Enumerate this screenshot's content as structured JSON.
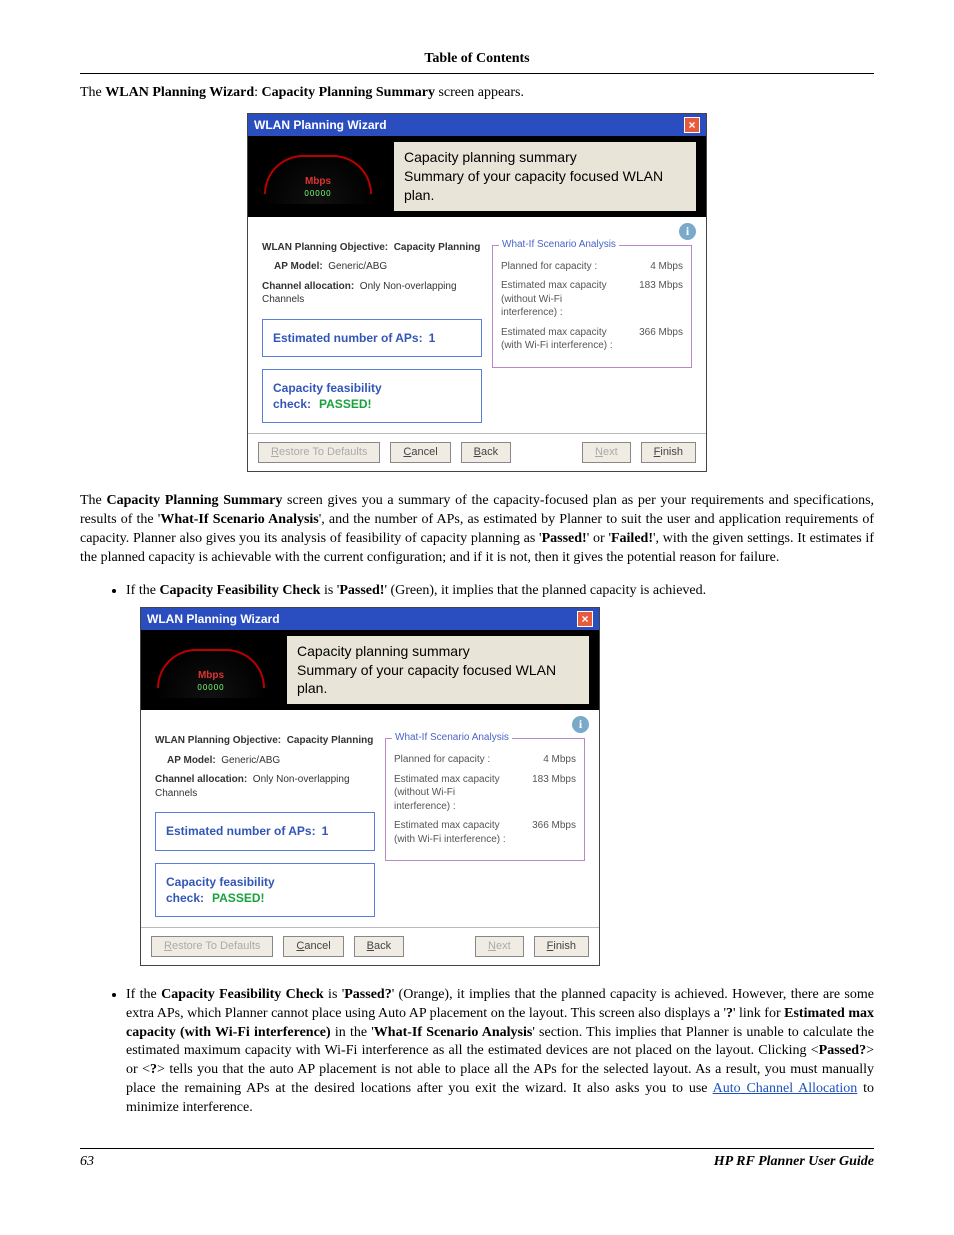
{
  "toc_header": "Table of Contents",
  "intro": {
    "pre": "The ",
    "b1": "WLAN Planning Wizard",
    "mid": ": ",
    "b2": "Capacity Planning Summary",
    "post": " screen appears."
  },
  "wizard": {
    "title": "WLAN Planning Wizard",
    "gauge_label": "Mbps",
    "gauge_digits": "00000",
    "heading": "Capacity planning summary",
    "subheading": "Summary of your capacity focused WLAN plan.",
    "objective_label": "WLAN Planning Objective:",
    "objective_value": "Capacity Planning",
    "ap_model_label": "AP Model:",
    "ap_model_value": "Generic/ABG",
    "channel_label": "Channel allocation:",
    "channel_value": "Only Non-overlapping Channels",
    "est_ap_label": "Estimated number of APs:",
    "est_ap_value": "1",
    "feas_label": "Capacity feasibility check:",
    "feas_value": "PASSED!",
    "whatif_legend": "What-If Scenario Analysis",
    "row1_label": "Planned for capacity :",
    "row1_value": "4 Mbps",
    "row2_label": "Estimated max capacity (without Wi-Fi interference) :",
    "row2_value": "183 Mbps",
    "row3_label": "Estimated max capacity (with Wi-Fi interference) :",
    "row3_value": "366 Mbps",
    "btn_restore": "Restore To Defaults",
    "btn_cancel": "Cancel",
    "btn_back": "Back",
    "btn_next": "Next",
    "btn_finish": "Finish"
  },
  "para1": {
    "a": "The ",
    "b": "Capacity Planning Summary",
    "c": " screen gives you a summary of the capacity-focused plan as per your requirements and specifications, results of the '",
    "d": "What-If Scenario Analysis",
    "e": "', and the number of APs, as estimated by Planner to suit the user and application requirements of capacity. Planner also gives you its analysis of feasibility of capacity planning as '",
    "f": "Passed!",
    "g": "' or '",
    "h": "Failed!",
    "i": "', with the given settings. It estimates if the planned capacity is achievable with the current configuration; and if it is not, then it gives the potential reason for failure."
  },
  "bullet1": {
    "a": "If the ",
    "b": "Capacity Feasibility Check",
    "c": " is '",
    "d": "Passed!",
    "e": "' (Green), it implies that the planned capacity is achieved."
  },
  "bullet2": {
    "a": "If the ",
    "b": "Capacity Feasibility Check",
    "c": " is '",
    "d": "Passed?",
    "e": "' (Orange), it implies that the planned capacity is achieved. However, there are some extra APs, which Planner cannot place using Auto AP placement on the layout. This screen also displays a '",
    "f": "?",
    "g": "' link for ",
    "h": "Estimated max capacity (with Wi-Fi interference)",
    "i": " in the '",
    "j": "What-If Scenario Analysis",
    "k": "' section. This implies that Planner is unable to calculate the estimated maximum capacity with Wi-Fi interference as all the estimated devices are not placed on the layout. Clicking <",
    "l": "Passed?",
    "m": "> or <",
    "n": "?",
    "o": "> tells you that the auto AP placement is not able to place all the APs for the selected layout. As a result, you must manually place the remaining APs at the desired locations after you exit the wizard. It also asks you to use ",
    "link": "Auto Channel Allocation",
    "p": " to minimize interference."
  },
  "footer": {
    "page": "63",
    "guide": "HP RF Planner User Guide"
  }
}
